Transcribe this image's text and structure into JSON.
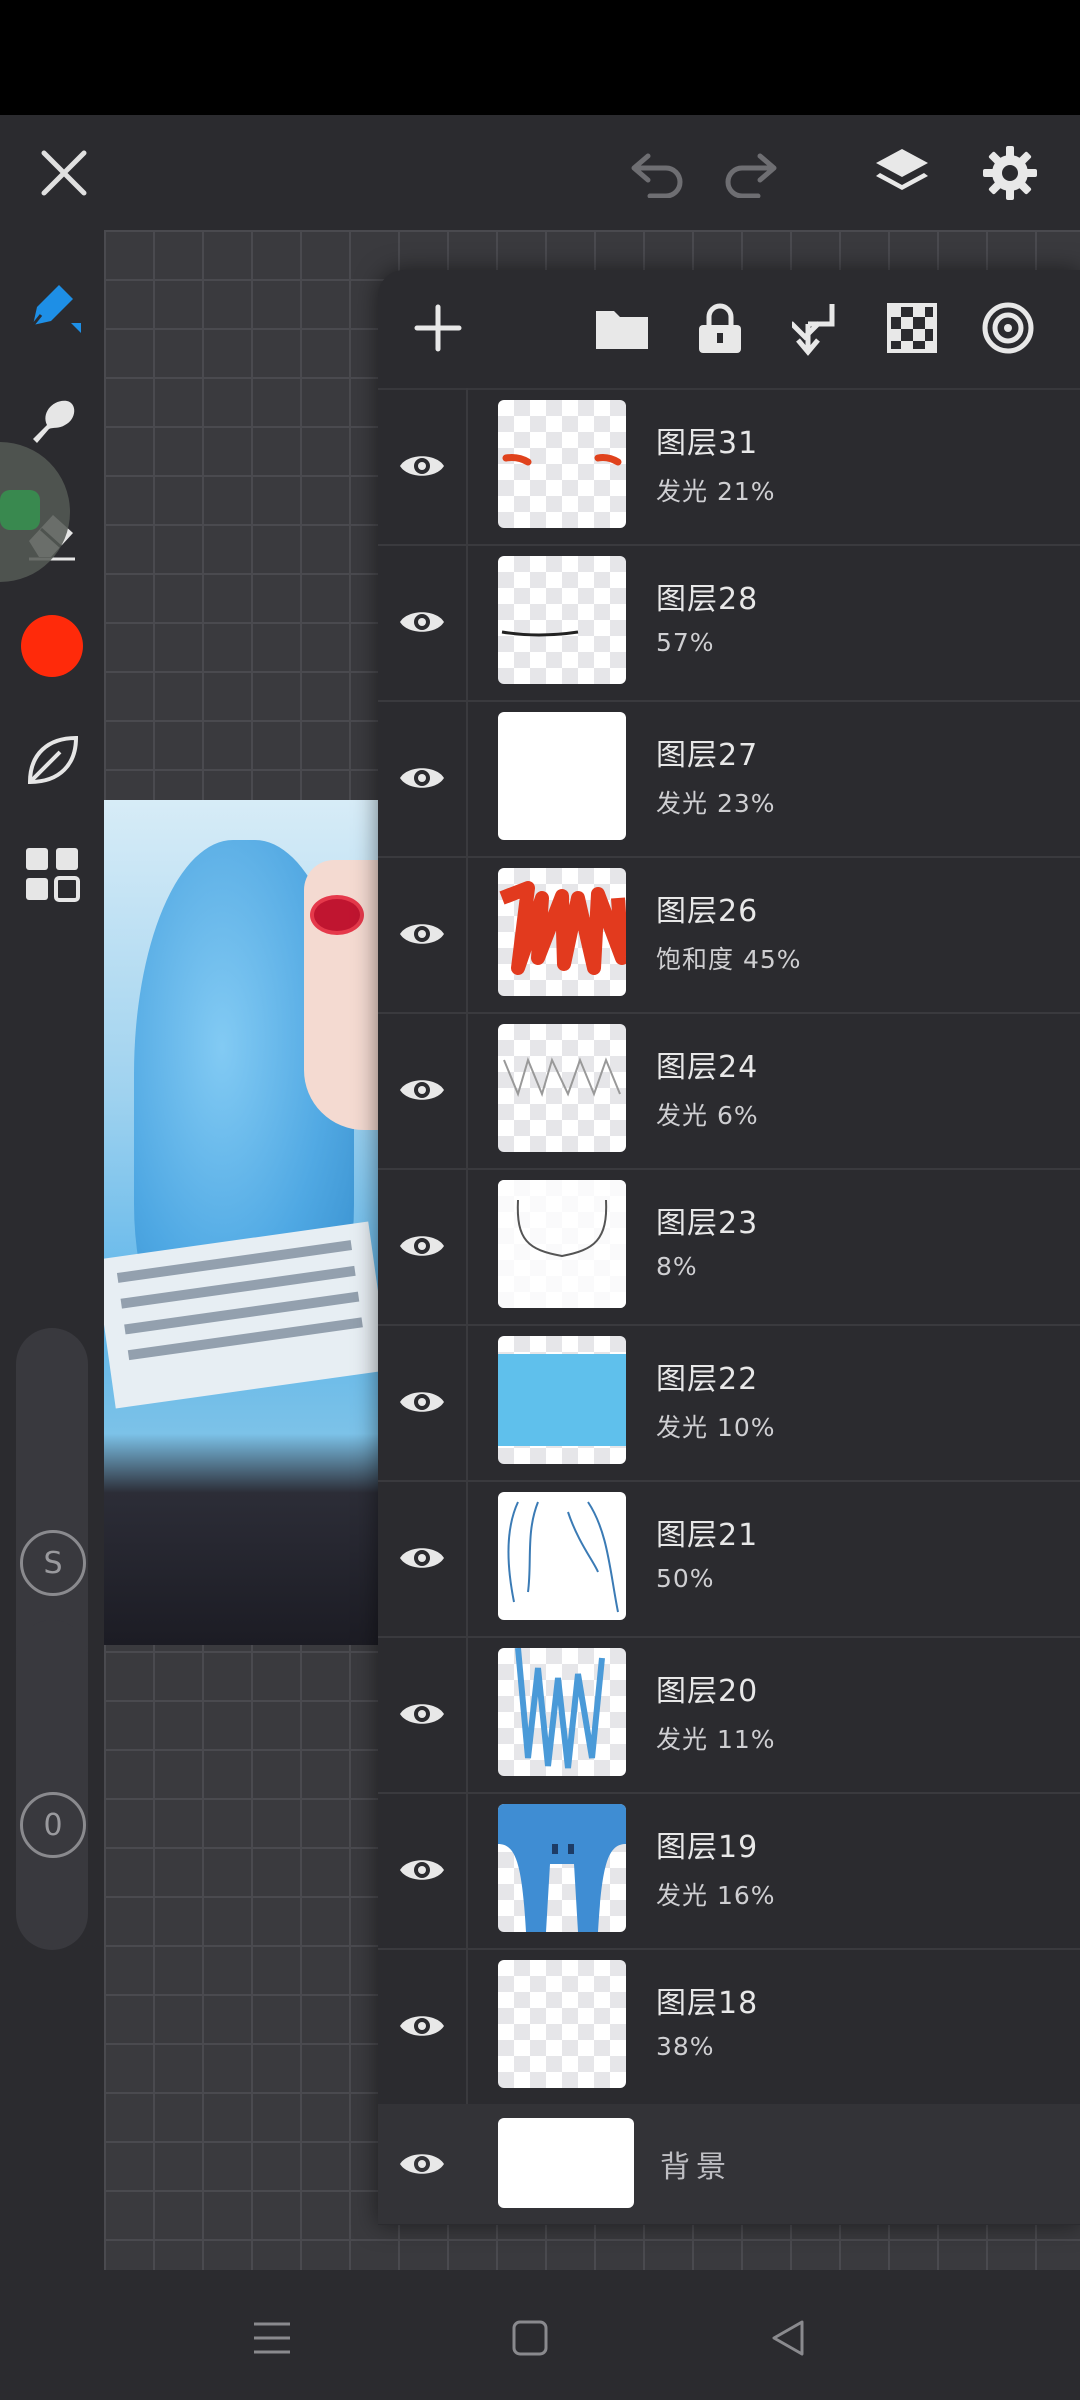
{
  "toolbar": {
    "close_icon": "close-icon",
    "undo_icon": "undo-icon",
    "redo_icon": "redo-icon",
    "layers_icon": "layers-icon",
    "settings_icon": "gear-icon"
  },
  "left_tools": {
    "brush_color": "#ff2a0a",
    "slider_size_label": "S",
    "slider_opacity_label": "0"
  },
  "layers_panel": {
    "toolbar_icons": [
      "plus-icon",
      "folder-icon",
      "lock-icon",
      "merge-down-icon",
      "transparency-icon",
      "target-icon"
    ],
    "layers": [
      {
        "name": "图层31",
        "sub": "发光  21%"
      },
      {
        "name": "图层28",
        "sub": "57%"
      },
      {
        "name": "图层27",
        "sub": "发光  23%"
      },
      {
        "name": "图层26",
        "sub": "饱和度  45%"
      },
      {
        "name": "图层24",
        "sub": "发光  6%"
      },
      {
        "name": "图层23",
        "sub": "8%"
      },
      {
        "name": "图层22",
        "sub": "发光  10%"
      },
      {
        "name": "图层21",
        "sub": "50%"
      },
      {
        "name": "图层20",
        "sub": "发光  11%"
      },
      {
        "name": "图层19",
        "sub": "发光  16%"
      },
      {
        "name": "图层18",
        "sub": "38%"
      }
    ],
    "background_layer": {
      "name": "背景"
    }
  },
  "nav": {
    "menu_icon": "menu-icon",
    "home_icon": "home-icon",
    "back_icon": "back-icon"
  }
}
